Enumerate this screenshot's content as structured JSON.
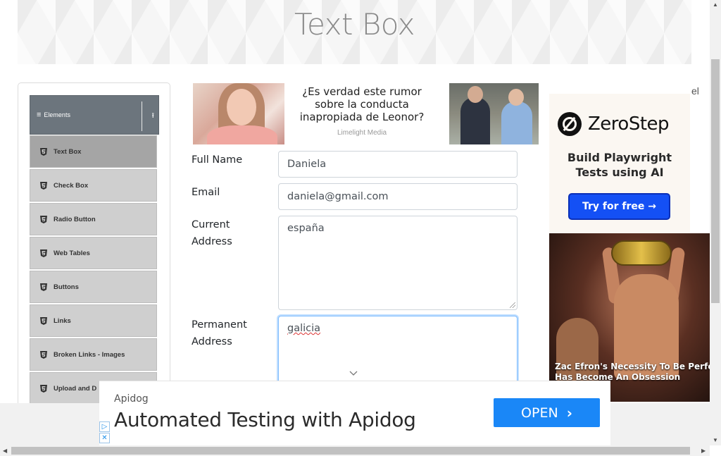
{
  "header": {
    "title": "Text Box"
  },
  "sidebar": {
    "group": {
      "label": "Elements",
      "icon": "hamburger-icon",
      "toggle_icon": "collapse-up-icon"
    },
    "items": [
      {
        "label": "Text Box",
        "active": true
      },
      {
        "label": "Check Box"
      },
      {
        "label": "Radio Button"
      },
      {
        "label": "Web Tables"
      },
      {
        "label": "Buttons"
      },
      {
        "label": "Links"
      },
      {
        "label": "Broken Links - Images"
      },
      {
        "label": "Upload and D"
      }
    ]
  },
  "ad_top": {
    "headline": "¿Es verdad este rumor sobre la conducta inapropiada de Leonor?",
    "source": "Limelight Media",
    "marker": "el"
  },
  "form": {
    "full_name": {
      "label": "Full Name",
      "value": "Daniela"
    },
    "email": {
      "label": "Email",
      "value": "daniela@gmail.com"
    },
    "current_address": {
      "label_line1": "Current",
      "label_line2": "Address",
      "value": "españa"
    },
    "permanent_address": {
      "label_line1": "Permanent",
      "label_line2": "Address",
      "value": "galicia"
    }
  },
  "ad_right": {
    "brand": "ZeroStep",
    "tagline_line1": "Build Playwright",
    "tagline_line2": "Tests using AI",
    "button": "Try for free →",
    "caption_line1": "Zac Efron's Necessity To Be Perfe",
    "caption_line2": "Has Become An Obsession"
  },
  "ad_bottom": {
    "brand": "Apidog",
    "headline": "Automated Testing with Apidog",
    "button": "OPEN",
    "button_arrow": "›"
  },
  "colors": {
    "sidebar_header": "#6c757d",
    "sidebar_item": "#cfcfcf",
    "sidebar_item_active": "#a5a5a5",
    "focus_border": "#80bdff",
    "zerostep_button": "#1450f5",
    "apidog_button": "#1a87f7"
  }
}
